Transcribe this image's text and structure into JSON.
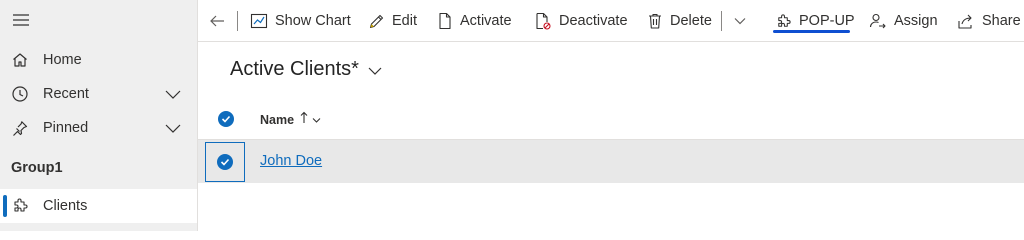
{
  "sidebar": {
    "items": [
      {
        "label": "Home",
        "icon": "home-icon"
      },
      {
        "label": "Recent",
        "icon": "clock-icon"
      },
      {
        "label": "Pinned",
        "icon": "pin-icon"
      }
    ],
    "group_label": "Group1",
    "entities": [
      {
        "label": "Clients",
        "icon": "puzzle-icon",
        "selected": true
      }
    ]
  },
  "commandbar": {
    "show_chart": "Show Chart",
    "edit": "Edit",
    "activate": "Activate",
    "deactivate": "Deactivate",
    "delete": "Delete",
    "popup": "POP-UP",
    "assign": "Assign",
    "share": "Share"
  },
  "view": {
    "title": "Active Clients*"
  },
  "grid": {
    "columns": [
      {
        "label": "Name",
        "sort": "ascending"
      }
    ],
    "rows": [
      {
        "name": "John Doe",
        "selected": true
      }
    ]
  },
  "colors": {
    "accent": "#0f6cbd",
    "popup_underline": "#0f4fd1",
    "sidebar_bg": "#efefef",
    "selected_row_bg": "#e8e8e8"
  }
}
